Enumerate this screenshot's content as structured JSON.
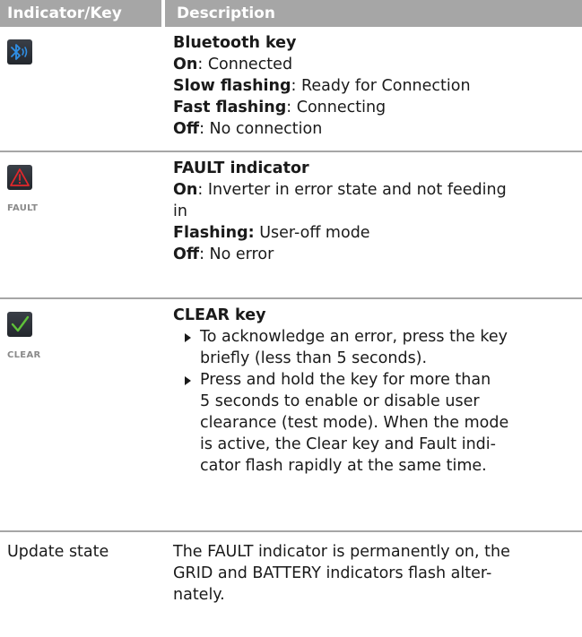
{
  "header": {
    "col1": "Indicator/Key",
    "col2": "Description"
  },
  "rows": [
    {
      "icon": "bluetooth-icon",
      "title": "Bluetooth key",
      "lines": [
        {
          "label": "On",
          "sep": ": ",
          "text": "Connected"
        },
        {
          "label": "Slow flashing",
          "sep": ": ",
          "text": "Ready for Connection"
        },
        {
          "label": "Fast flashing",
          "sep": ": ",
          "text": "Connecting"
        },
        {
          "label": "Off",
          "sep": ": ",
          "text": "No connection"
        }
      ]
    },
    {
      "icon": "warning-triangle-icon",
      "icon_label": "FAULT",
      "title": "FAULT indicator",
      "lines": [
        {
          "label": "On",
          "sep": ": ",
          "text1": "Inverter in error state and not feeding",
          "text2": "in"
        },
        {
          "label": "Flashing:",
          "sep": " ",
          "text": "User-off mode"
        },
        {
          "label": "Off",
          "sep": ": ",
          "text": "No error"
        }
      ]
    },
    {
      "icon": "check-mark-icon",
      "icon_label": "CLEAR",
      "title": "CLEAR key",
      "bullets": [
        [
          "To acknowledge an error, press the key",
          "briefly (less than 5 seconds)."
        ],
        [
          "Press and hold the key for more than",
          "5 seconds to enable or disable user",
          "clearance (test mode). When the mode",
          "is active, the Clear key and Fault indi-",
          "cator flash rapidly at the same time."
        ]
      ]
    },
    {
      "label": "Update state",
      "text": [
        "The FAULT indicator is permanently on, the",
        "GRID and BATTERY indicators flash alter-",
        "nately."
      ]
    }
  ],
  "colors": {
    "header_bg": "#a6a6a6",
    "icon_bg": "#2b2f35",
    "bluetooth": "#2f8fe6",
    "fault": "#e2272b",
    "clear": "#5fc139"
  }
}
